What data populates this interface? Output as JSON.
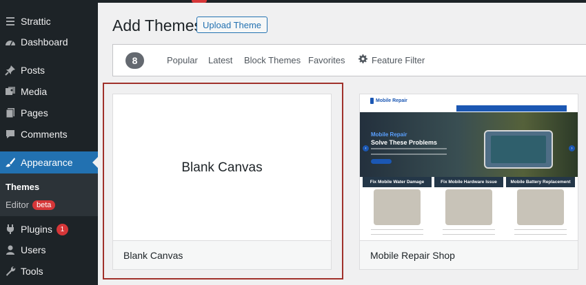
{
  "sidebar": {
    "items": [
      {
        "id": "strattic",
        "label": "Strattic",
        "icon": "strattic-icon"
      },
      {
        "id": "dashboard",
        "label": "Dashboard",
        "icon": "dashboard-icon"
      },
      {
        "id": "posts",
        "label": "Posts",
        "icon": "pin-icon"
      },
      {
        "id": "media",
        "label": "Media",
        "icon": "media-icon"
      },
      {
        "id": "pages",
        "label": "Pages",
        "icon": "pages-icon"
      },
      {
        "id": "comments",
        "label": "Comments",
        "icon": "comment-icon"
      },
      {
        "id": "appearance",
        "label": "Appearance",
        "icon": "brush-icon"
      },
      {
        "id": "plugins",
        "label": "Plugins",
        "icon": "plug-icon",
        "badge": "1"
      },
      {
        "id": "users",
        "label": "Users",
        "icon": "user-icon"
      },
      {
        "id": "tools",
        "label": "Tools",
        "icon": "wrench-icon"
      }
    ],
    "submenu": {
      "themes": "Themes",
      "editor": "Editor",
      "editor_badge": "beta"
    }
  },
  "header": {
    "title": "Add Themes",
    "upload_button": "Upload Theme"
  },
  "filter": {
    "count": "8",
    "tabs": [
      "Popular",
      "Latest",
      "Block Themes",
      "Favorites"
    ],
    "feature_filter": "Feature Filter"
  },
  "themes": [
    {
      "name": "Blank Canvas",
      "preview_title": "Blank Canvas"
    },
    {
      "name": "Mobile Repair Shop",
      "preview": {
        "logo": "Mobile Repair",
        "headline1": "Mobile Repair",
        "headline2": "Solve These Problems",
        "services": [
          "Fix Mobile Water Damage",
          "Fix Mobile Hardware Issue",
          "Mobile Battery Replacement"
        ]
      }
    }
  ],
  "colors": {
    "sidebar_bg": "#1d2327",
    "accent": "#2271b1",
    "highlight_border": "#a0302a",
    "badge_red": "#d63638"
  }
}
